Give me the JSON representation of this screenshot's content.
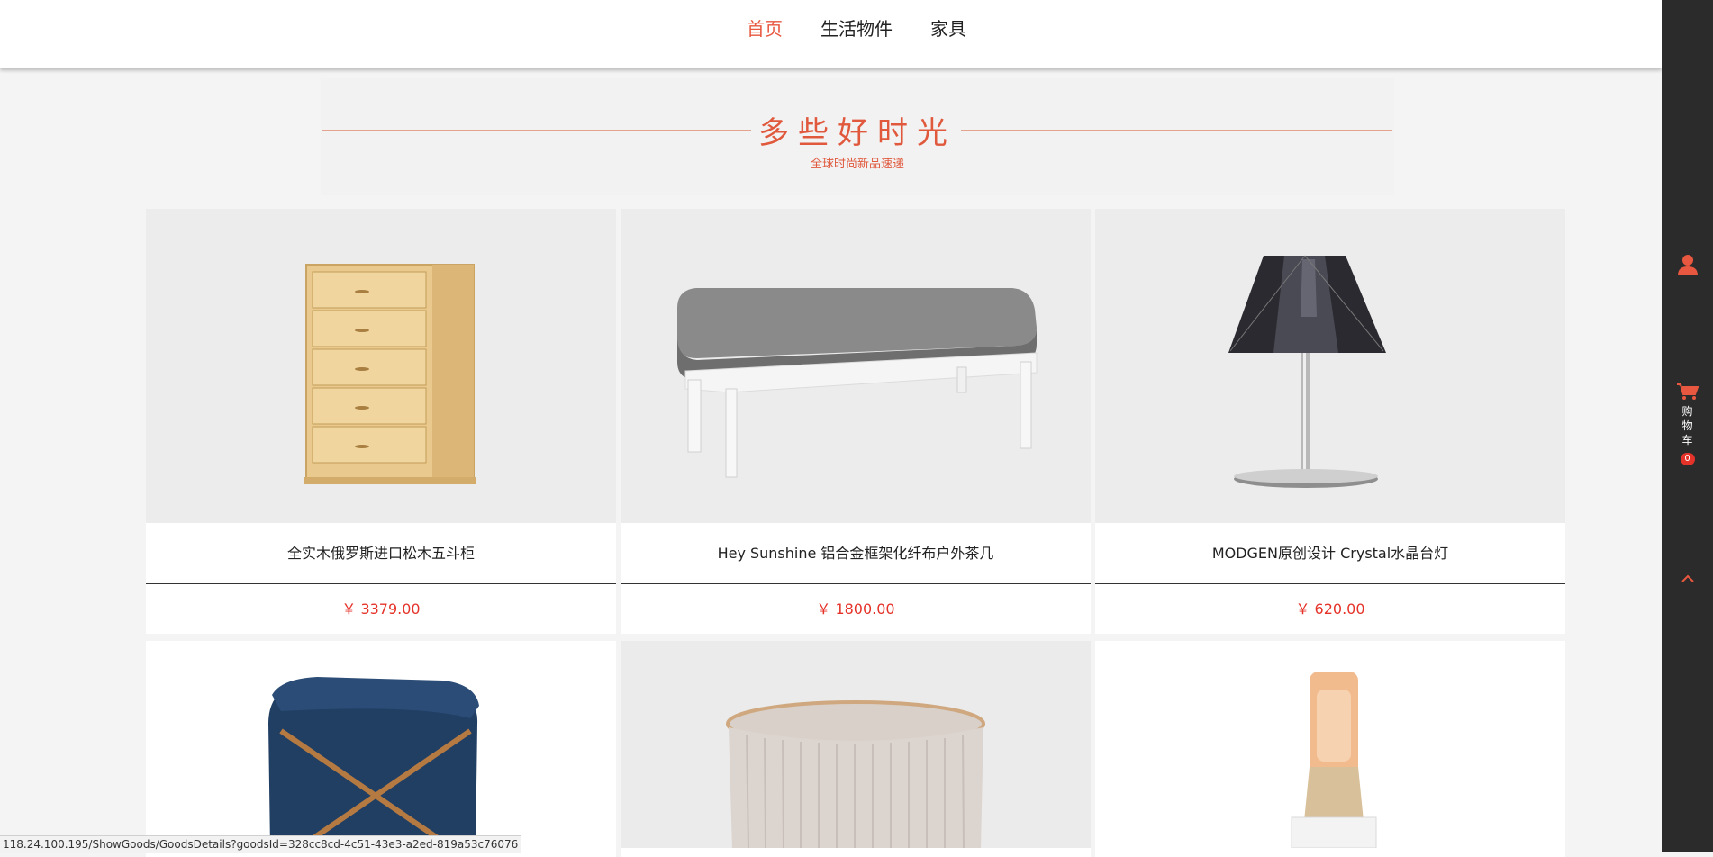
{
  "nav": {
    "items": [
      {
        "label": "首页",
        "active": true
      },
      {
        "label": "生活物件",
        "active": false
      },
      {
        "label": "家具",
        "active": false
      }
    ]
  },
  "section": {
    "title": "多些好时光",
    "subtitle": "全球时尚新品速递"
  },
  "products": [
    {
      "name": "全实木俄罗斯进口松木五斗柜",
      "price": "￥ 3379.00",
      "image": "chest-of-drawers"
    },
    {
      "name": "Hey Sunshine 铝合金框架化纤布户外茶几",
      "price": "￥ 1800.00",
      "image": "outdoor-table"
    },
    {
      "name": "MODGEN原创设计 Crystal水晶台灯",
      "price": "￥ 620.00",
      "image": "crystal-lamp"
    },
    {
      "name": "",
      "price": "",
      "image": "laundry-basket"
    },
    {
      "name": "",
      "price": "",
      "image": "storage-basket"
    },
    {
      "name": "",
      "price": "",
      "image": "salt-lamp"
    }
  ],
  "sidebar": {
    "user_icon": "user-icon",
    "cart_icon": "cart-icon",
    "cart_label": "购物车",
    "cart_count": "0",
    "top_icon": "chevron-up-icon"
  },
  "statusbar": {
    "url": "118.24.100.195/ShowGoods/GoodsDetails?goodsId=328cc8cd-4c51-43e3-a2ed-819a53c76076"
  },
  "colors": {
    "accent": "#e8573f",
    "price": "#e5332a",
    "sidebar": "#2b2b2b"
  }
}
